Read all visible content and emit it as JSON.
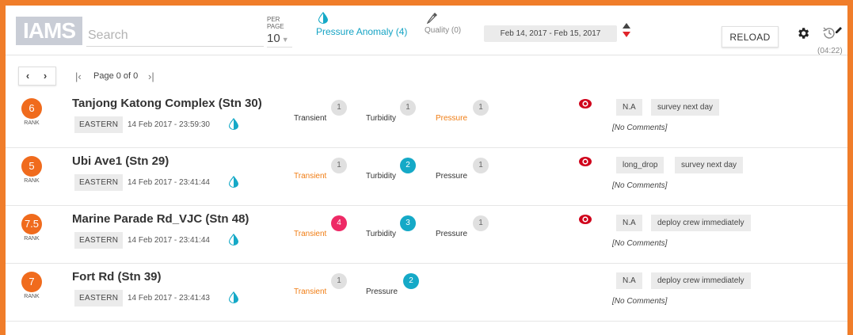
{
  "header": {
    "logo": "IAMS",
    "search_placeholder": "Search",
    "per_page_label": "PER PAGE",
    "per_page_value": "10",
    "pressure_filter_label": "Pressure Anomaly (4)",
    "quality_filter_label": "Quality (0)",
    "date_range": "Feb 14, 2017 - Feb 15, 2017",
    "reload_label": "RELOAD",
    "timer": "(04:22)"
  },
  "pagination": {
    "page_text": "Page 0 of 0"
  },
  "colors": {
    "frame": "#f07d2a",
    "rank": "#f06b1d",
    "teal": "#15a9c7",
    "pink": "#ee2a66",
    "alert_label": "#f07d14",
    "eye": "#d0021b"
  },
  "stations": [
    {
      "rank": "6",
      "rank_label": "RANK",
      "name": "Tanjong Katong Complex (Stn 30)",
      "region": "EASTERN",
      "timestamp": "14 Feb 2017 - 23:59:30",
      "metrics": [
        {
          "label": "Transient",
          "count": "1",
          "style": "grey",
          "alert": false
        },
        {
          "label": "Turbidity",
          "count": "1",
          "style": "grey",
          "alert": false
        },
        {
          "label": "Pressure",
          "count": "1",
          "style": "grey",
          "alert": true
        }
      ],
      "has_eye": true,
      "tags": [
        "N.A",
        "survey next day"
      ],
      "comment": "[No Comments]"
    },
    {
      "rank": "5",
      "rank_label": "RANK",
      "name": "Ubi Ave1 (Stn 29)",
      "region": "EASTERN",
      "timestamp": "14 Feb 2017 - 23:41:44",
      "metrics": [
        {
          "label": "Transient",
          "count": "1",
          "style": "grey",
          "alert": true
        },
        {
          "label": "Turbidity",
          "count": "2",
          "style": "teal",
          "alert": false
        },
        {
          "label": "Pressure",
          "count": "1",
          "style": "grey",
          "alert": false
        }
      ],
      "has_eye": true,
      "tags": [
        "long_drop",
        "survey next day"
      ],
      "comment": "[No Comments]"
    },
    {
      "rank": "7.5",
      "rank_label": "RANK",
      "name": "Marine Parade Rd_VJC (Stn 48)",
      "region": "EASTERN",
      "timestamp": "14 Feb 2017 - 23:41:44",
      "metrics": [
        {
          "label": "Transient",
          "count": "4",
          "style": "pink",
          "alert": true
        },
        {
          "label": "Turbidity",
          "count": "3",
          "style": "teal",
          "alert": false
        },
        {
          "label": "Pressure",
          "count": "1",
          "style": "grey",
          "alert": false
        }
      ],
      "has_eye": true,
      "tags": [
        "N.A",
        "deploy crew immediately"
      ],
      "comment": "[No Comments]"
    },
    {
      "rank": "7",
      "rank_label": "RANK",
      "name": "Fort Rd (Stn 39)",
      "region": "EASTERN",
      "timestamp": "14 Feb 2017 - 23:41:43",
      "metrics": [
        {
          "label": "Transient",
          "count": "1",
          "style": "grey",
          "alert": true
        },
        {
          "label": "Pressure",
          "count": "2",
          "style": "teal",
          "alert": false
        }
      ],
      "has_eye": false,
      "tags": [
        "N.A",
        "deploy crew immediately"
      ],
      "comment": "[No Comments]"
    }
  ]
}
